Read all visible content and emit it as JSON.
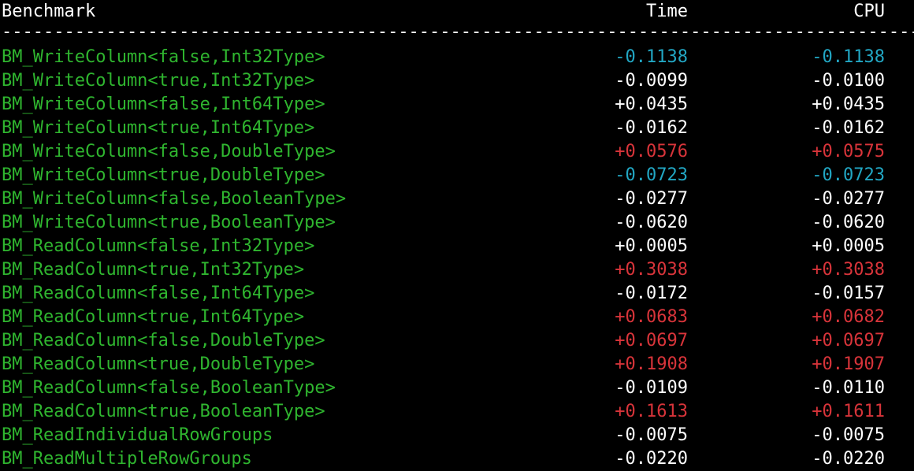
{
  "header": {
    "benchmark": "Benchmark",
    "time": "Time",
    "cpu": "CPU",
    "separator": "------------------------------------------------------------------------------------------------------------"
  },
  "colors": {
    "background": "#000000",
    "name": "#2fb52f",
    "neutral": "#ffffff",
    "improvement": "#22a7c4",
    "regression": "#d8343a"
  },
  "rows": [
    {
      "name": "BM_WriteColumn<false,Int32Type>",
      "time": "-0.1138",
      "cpu": "-0.1138",
      "time_color": "improvement",
      "cpu_color": "improvement"
    },
    {
      "name": "BM_WriteColumn<true,Int32Type>",
      "time": "-0.0099",
      "cpu": "-0.0100",
      "time_color": "neutral",
      "cpu_color": "neutral"
    },
    {
      "name": "BM_WriteColumn<false,Int64Type>",
      "time": "+0.0435",
      "cpu": "+0.0435",
      "time_color": "neutral",
      "cpu_color": "neutral"
    },
    {
      "name": "BM_WriteColumn<true,Int64Type>",
      "time": "-0.0162",
      "cpu": "-0.0162",
      "time_color": "neutral",
      "cpu_color": "neutral"
    },
    {
      "name": "BM_WriteColumn<false,DoubleType>",
      "time": "+0.0576",
      "cpu": "+0.0575",
      "time_color": "regression",
      "cpu_color": "regression"
    },
    {
      "name": "BM_WriteColumn<true,DoubleType>",
      "time": "-0.0723",
      "cpu": "-0.0723",
      "time_color": "improvement",
      "cpu_color": "improvement"
    },
    {
      "name": "BM_WriteColumn<false,BooleanType>",
      "time": "-0.0277",
      "cpu": "-0.0277",
      "time_color": "neutral",
      "cpu_color": "neutral"
    },
    {
      "name": "BM_WriteColumn<true,BooleanType>",
      "time": "-0.0620",
      "cpu": "-0.0620",
      "time_color": "neutral",
      "cpu_color": "neutral"
    },
    {
      "name": "BM_ReadColumn<false,Int32Type>",
      "time": "+0.0005",
      "cpu": "+0.0005",
      "time_color": "neutral",
      "cpu_color": "neutral"
    },
    {
      "name": "BM_ReadColumn<true,Int32Type>",
      "time": "+0.3038",
      "cpu": "+0.3038",
      "time_color": "regression",
      "cpu_color": "regression"
    },
    {
      "name": "BM_ReadColumn<false,Int64Type>",
      "time": "-0.0172",
      "cpu": "-0.0157",
      "time_color": "neutral",
      "cpu_color": "neutral"
    },
    {
      "name": "BM_ReadColumn<true,Int64Type>",
      "time": "+0.0683",
      "cpu": "+0.0682",
      "time_color": "regression",
      "cpu_color": "regression"
    },
    {
      "name": "BM_ReadColumn<false,DoubleType>",
      "time": "+0.0697",
      "cpu": "+0.0697",
      "time_color": "regression",
      "cpu_color": "regression"
    },
    {
      "name": "BM_ReadColumn<true,DoubleType>",
      "time": "+0.1908",
      "cpu": "+0.1907",
      "time_color": "regression",
      "cpu_color": "regression"
    },
    {
      "name": "BM_ReadColumn<false,BooleanType>",
      "time": "-0.0109",
      "cpu": "-0.0110",
      "time_color": "neutral",
      "cpu_color": "neutral"
    },
    {
      "name": "BM_ReadColumn<true,BooleanType>",
      "time": "+0.1613",
      "cpu": "+0.1611",
      "time_color": "regression",
      "cpu_color": "regression"
    },
    {
      "name": "BM_ReadIndividualRowGroups",
      "time": "-0.0075",
      "cpu": "-0.0075",
      "time_color": "neutral",
      "cpu_color": "neutral"
    },
    {
      "name": "BM_ReadMultipleRowGroups",
      "time": "-0.0220",
      "cpu": "-0.0220",
      "time_color": "neutral",
      "cpu_color": "neutral"
    }
  ]
}
